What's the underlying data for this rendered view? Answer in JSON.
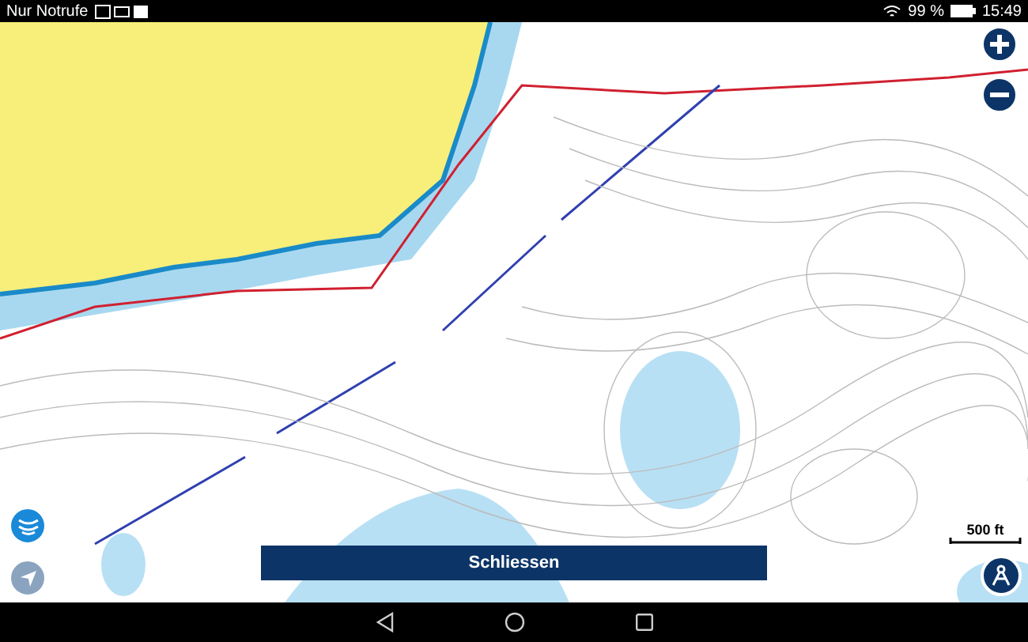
{
  "status_bar": {
    "carrier": "Nur Notrufe",
    "battery": "99 %",
    "time": "15:49"
  },
  "map": {
    "scale_label": "500 ft"
  },
  "close_button": {
    "label": "Schliessen"
  }
}
